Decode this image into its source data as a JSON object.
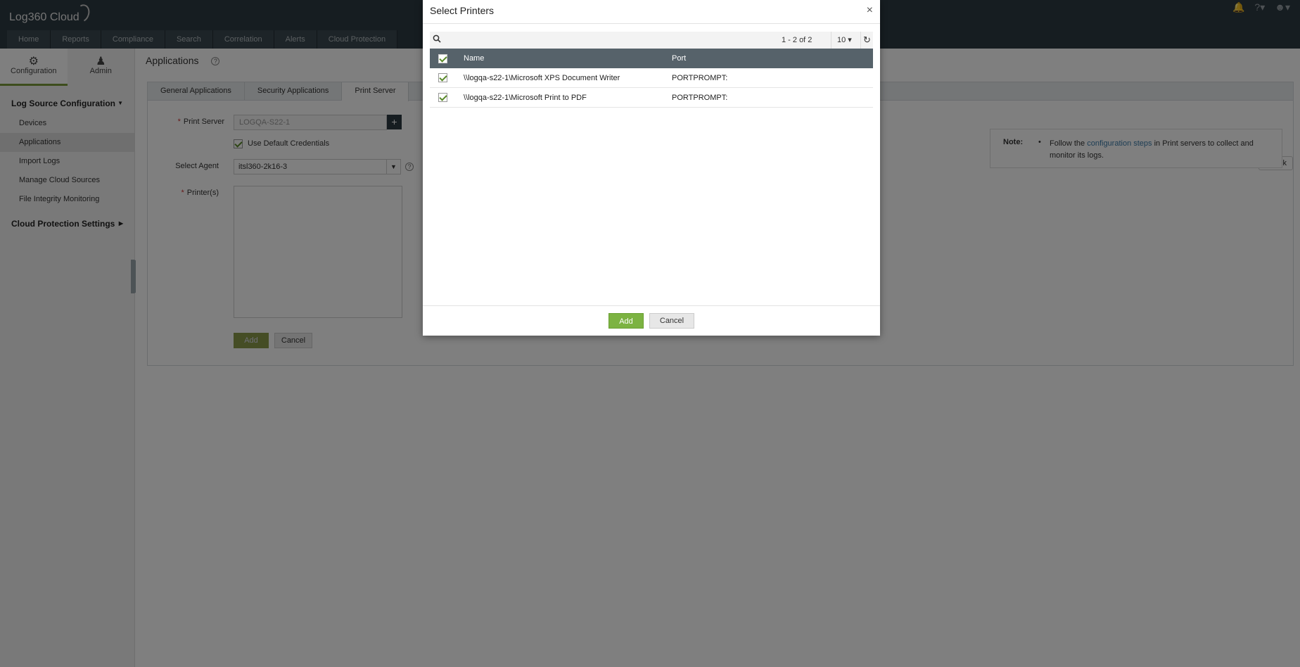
{
  "app": {
    "logo_text": "Log360 Cloud"
  },
  "top_icons": [
    "bell-icon",
    "help-icon",
    "user-icon"
  ],
  "nav": [
    "Home",
    "Reports",
    "Compliance",
    "Search",
    "Correlation",
    "Alerts",
    "Cloud Protection"
  ],
  "side_tabs": {
    "configuration": "Configuration",
    "admin": "Admin"
  },
  "sidebar": {
    "section1": "Log Source Configuration",
    "items": [
      "Devices",
      "Applications",
      "Import Logs",
      "Manage Cloud Sources",
      "File Integrity Monitoring"
    ],
    "section2": "Cloud Protection Settings"
  },
  "page": {
    "title": "Applications",
    "tabs": [
      "General Applications",
      "Security Applications",
      "Print Server"
    ],
    "form": {
      "print_server_label": "Print Server",
      "print_server_value": "LOGQA-S22-1",
      "use_default_credentials": "Use Default Credentials",
      "select_agent_label": "Select Agent",
      "select_agent_value": "itsl360-2k16-3",
      "printers_label": "Printer(s)",
      "add": "Add",
      "cancel": "Cancel"
    },
    "back": "Back",
    "note": {
      "title": "Note:",
      "text_before": "Follow the ",
      "link": "configuration steps",
      "text_after": " in Print servers to collect and monitor its logs."
    }
  },
  "dialog": {
    "title": "Select Printers",
    "close": "×",
    "pager": "1 - 2 of 2",
    "page_size": "10",
    "columns": {
      "name": "Name",
      "port": "Port"
    },
    "rows": [
      {
        "name": "\\\\logqa-s22-1\\Microsoft XPS Document Writer",
        "port": "PORTPROMPT:"
      },
      {
        "name": "\\\\logqa-s22-1\\Microsoft Print to PDF",
        "port": "PORTPROMPT:"
      }
    ],
    "add": "Add",
    "cancel": "Cancel"
  }
}
